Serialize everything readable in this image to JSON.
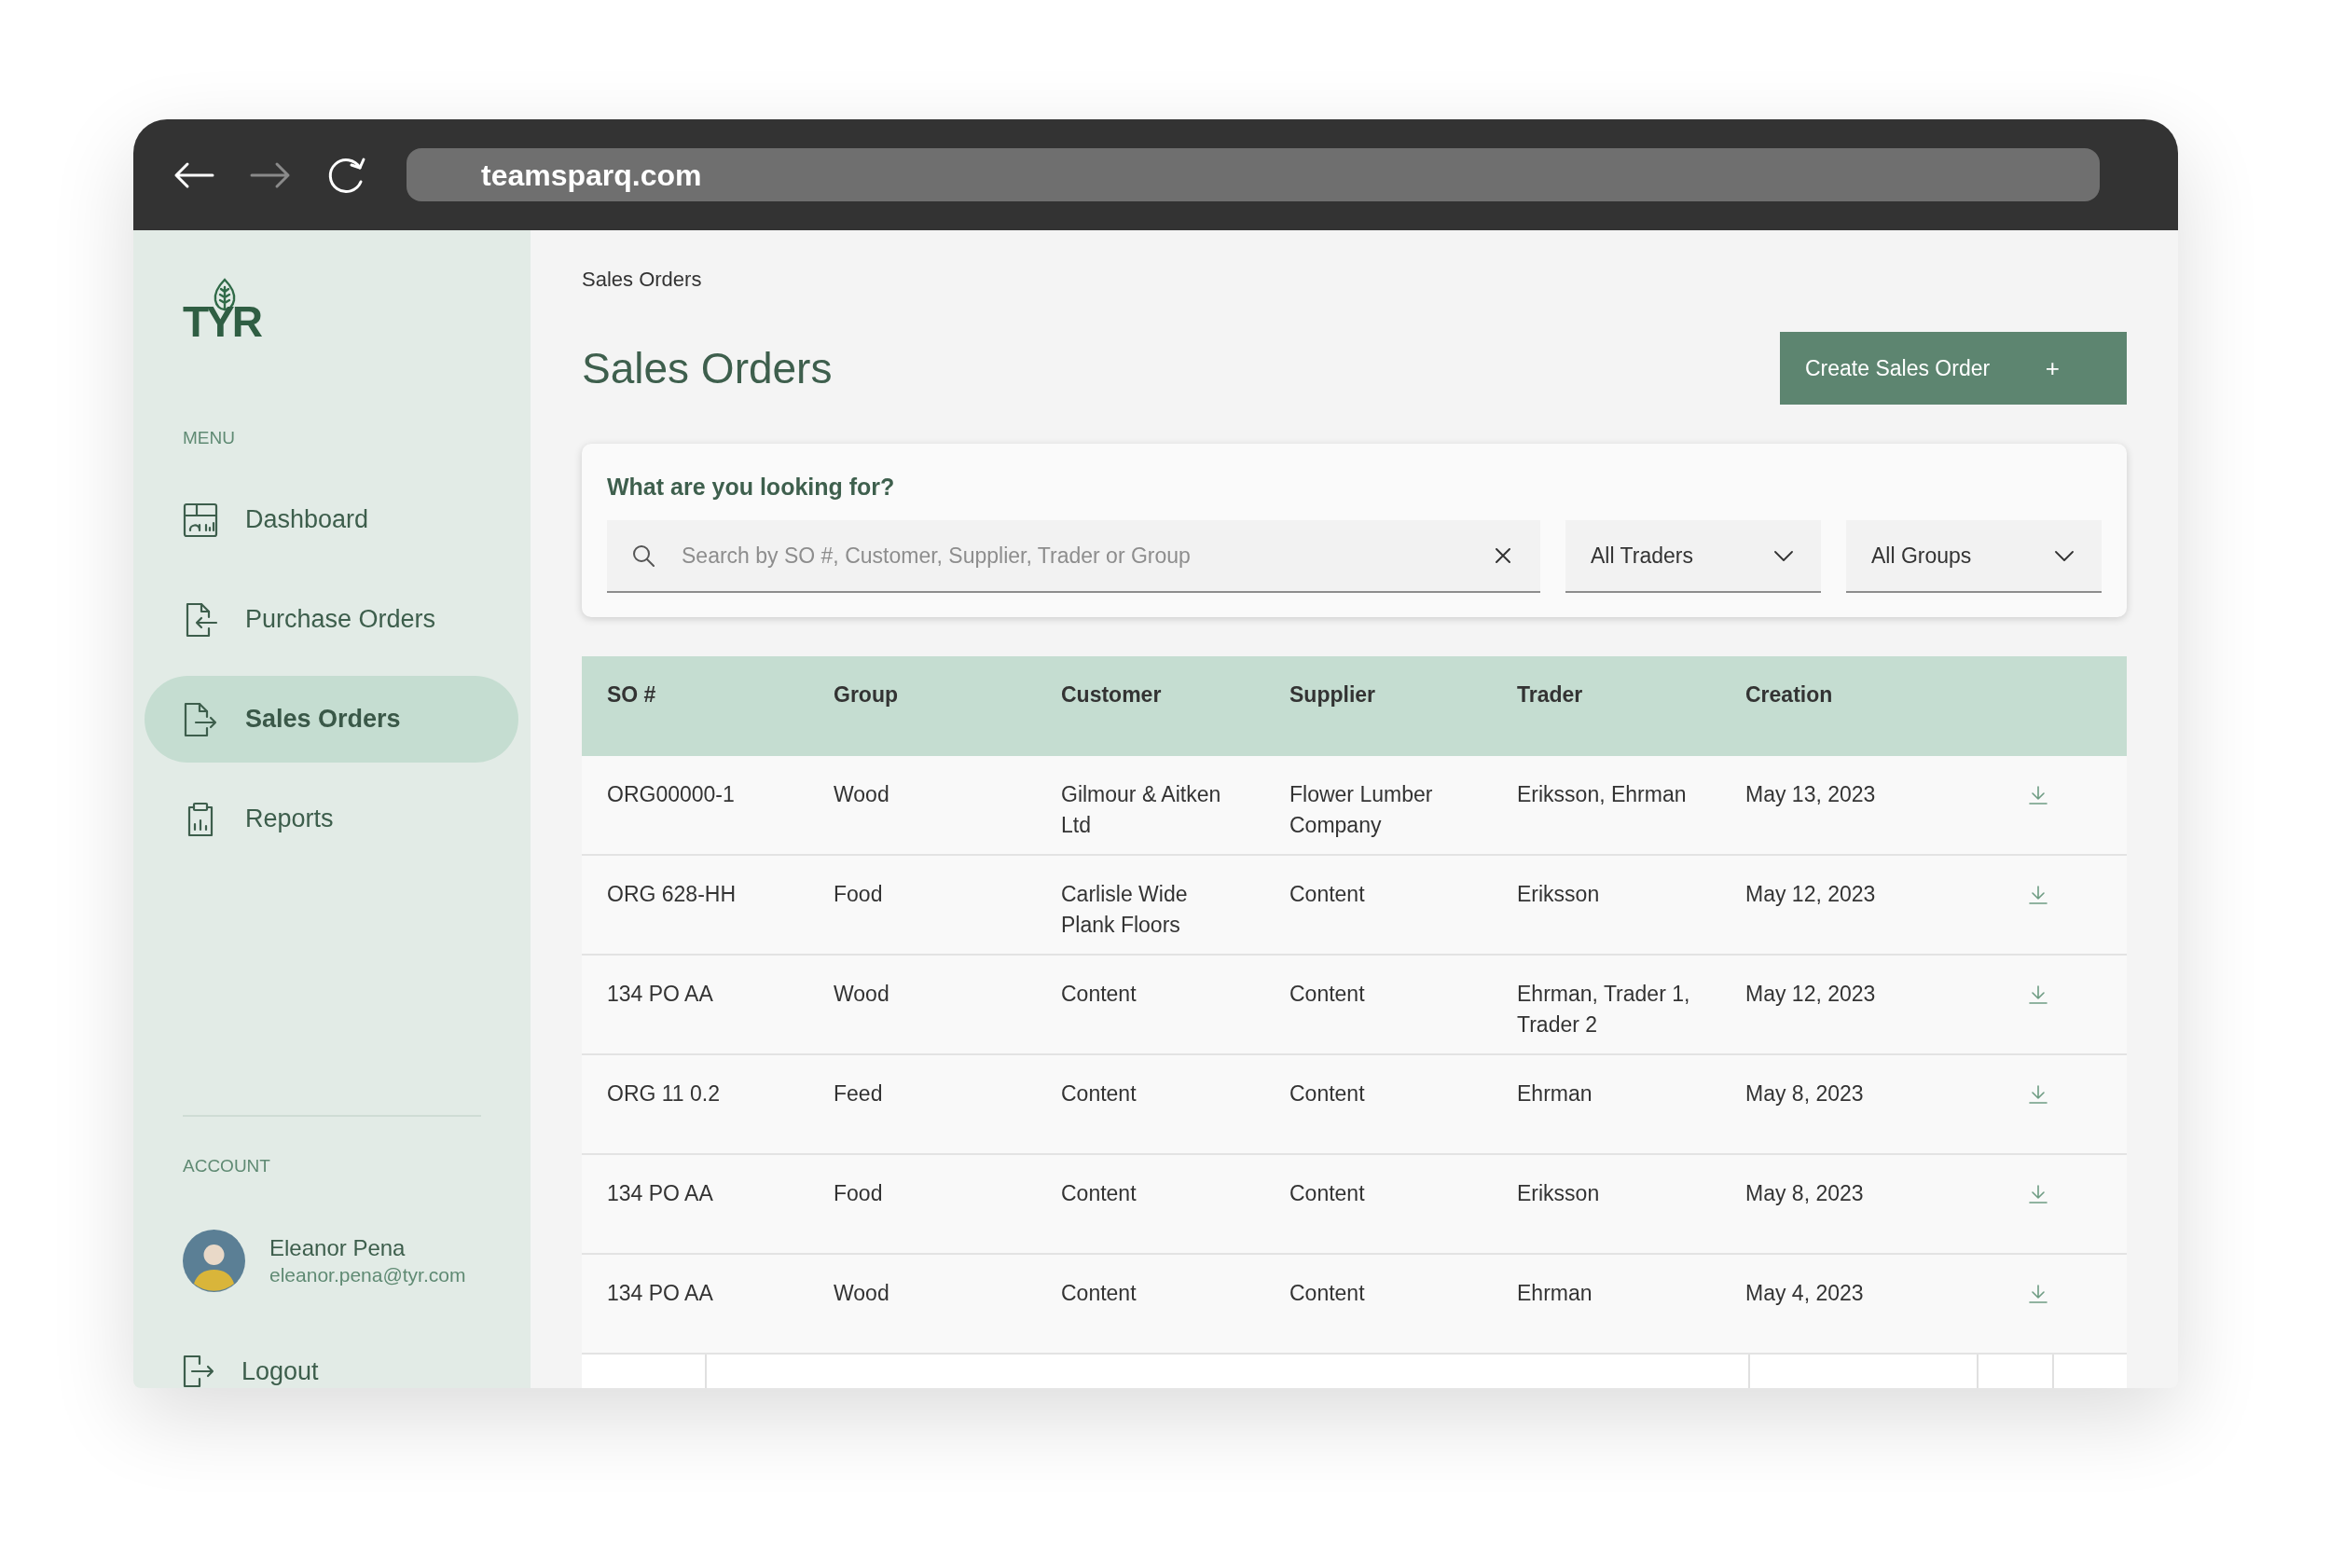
{
  "browser": {
    "buttons": [
      {
        "kind": "back",
        "disabled": false
      },
      {
        "kind": "forward",
        "disabled": true
      },
      {
        "kind": "reload",
        "disabled": false
      }
    ],
    "url": "teamsparq.com"
  },
  "sidebar": {
    "logo": "TYR",
    "menu_label": "MENU",
    "items": [
      {
        "label": "Dashboard",
        "selected": false
      },
      {
        "label": "Purchase Orders",
        "selected": false
      },
      {
        "label": "Sales Orders",
        "selected": true
      },
      {
        "label": "Reports",
        "selected": false
      }
    ],
    "account_label": "ACCOUNT",
    "user": {
      "name": "Eleanor Pena",
      "email": "eleanor.pena@tyr.com"
    },
    "logout": "Logout"
  },
  "breadcrumb": "Sales Orders",
  "title": "Sales Orders",
  "create_button": {
    "label": "Create Sales Order",
    "plus": "+"
  },
  "search_card": {
    "heading": "What are you looking for?",
    "search": {
      "placeholder": "Search by SO #, Customer, Supplier, Trader or Group"
    },
    "filters": [
      {
        "value": "All Traders"
      },
      {
        "value": "All Groups"
      }
    ]
  },
  "table": {
    "columns": [
      "SO #",
      "Group",
      "Customer",
      "Supplier",
      "Trader",
      "Creation"
    ],
    "rows": [
      [
        "ORG00000-1",
        "Wood",
        "Gilmour & Aitken Ltd",
        "Flower Lumber Company",
        "Eriksson, Ehrman",
        "May 13, 2023"
      ],
      [
        "ORG 628-HH",
        "Food",
        "Carlisle Wide Plank Floors",
        "Content",
        "Eriksson",
        "May 12, 2023"
      ],
      [
        "134 PO AA",
        "Wood",
        "Content",
        "Content",
        "Ehrman, Trader 1, Trader 2",
        "May 12, 2023"
      ],
      [
        "ORG 11 0.2",
        "Feed",
        "Content",
        "Content",
        "Ehrman",
        "May 8, 2023"
      ],
      [
        "134 PO AA",
        "Food",
        "Content",
        "Content",
        "Eriksson",
        "May 8, 2023"
      ],
      [
        "134 PO AA",
        "Wood",
        "Content",
        "Content",
        "Ehrman",
        "May 4, 2023"
      ]
    ]
  }
}
